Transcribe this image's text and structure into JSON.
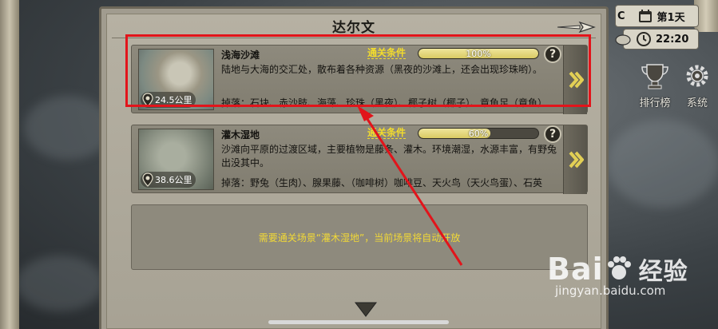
{
  "region_title": "达尔文",
  "hud": {
    "day_label": "第1天",
    "time": "22:20",
    "clipped_letter": "C",
    "leaderboard_label": "排行榜",
    "settings_label": "系统"
  },
  "scenes": [
    {
      "name": "浅海沙滩",
      "clear_condition_label": "通关条件",
      "progress": 100,
      "progress_label": "100%",
      "distance": "24.5公里",
      "description": "陆地与大海的交汇处，散布着各种资源（黑夜的沙滩上，还会出现珍珠哟）。",
      "drops": "掉落：石块、赤沙肢、海藻、珍珠（黑夜）、椰子树（椰子）、章鱼足（章鱼）",
      "help": "?",
      "highlighted": true
    },
    {
      "name": "灌木湿地",
      "clear_condition_label": "通关条件",
      "progress": 60,
      "progress_label": "60%",
      "distance": "38.6公里",
      "description": "沙滩向平原的过渡区域，主要植物是藤条、灌木。环境潮湿，水源丰富，有野兔出没其中。",
      "drops": "掉落：野兔（生肉）、腺果藤、（咖啡树）咖啡豆、天火鸟（天火鸟蛋）、石英",
      "help": "?",
      "highlighted": false
    }
  ],
  "locked_message": "需要通关场景“灌木湿地”，当前场景将自动开放",
  "watermark": {
    "logo": "Bai",
    "logo_suffix": "经验",
    "url": "jingyan.baidu.com"
  },
  "colors": {
    "highlight": "#e2141b",
    "condition_text": "#f3dc2c",
    "progress_fill": "#e2d67a"
  }
}
